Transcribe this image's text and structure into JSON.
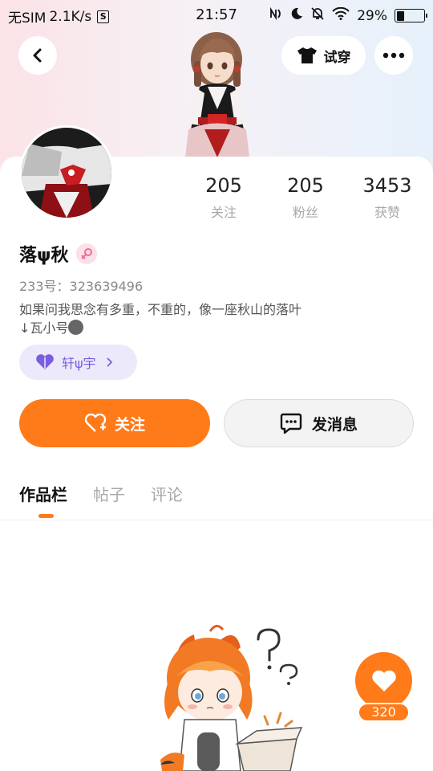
{
  "status_bar": {
    "carrier": "无SIM",
    "speed": "2.1K/s",
    "s_badge": "S",
    "time": "21:57",
    "battery_percent": "29%",
    "battery_level": 0.29
  },
  "header": {
    "try_on_label": "试穿"
  },
  "stats": [
    {
      "value": "205",
      "label": "关注"
    },
    {
      "value": "205",
      "label": "粉丝"
    },
    {
      "value": "3453",
      "label": "获赞"
    }
  ],
  "profile": {
    "name": "落ψ秋",
    "uid": "233号：323639496",
    "bio_line1": "如果问我思念有多重，不重的，像一座秋山的落叶",
    "bio_line2": "↓瓦小号"
  },
  "fan_badge": {
    "label": "轩ψ宇"
  },
  "actions": {
    "follow_label": "关注",
    "message_label": "发消息"
  },
  "tabs": [
    {
      "label": "作品栏",
      "active": true
    },
    {
      "label": "帖子",
      "active": false
    },
    {
      "label": "评论",
      "active": false
    }
  ],
  "like": {
    "count": "320"
  },
  "colors": {
    "accent": "#ff7a19",
    "badge_bg": "#ece9fa",
    "badge_text": "#7a5de0"
  }
}
